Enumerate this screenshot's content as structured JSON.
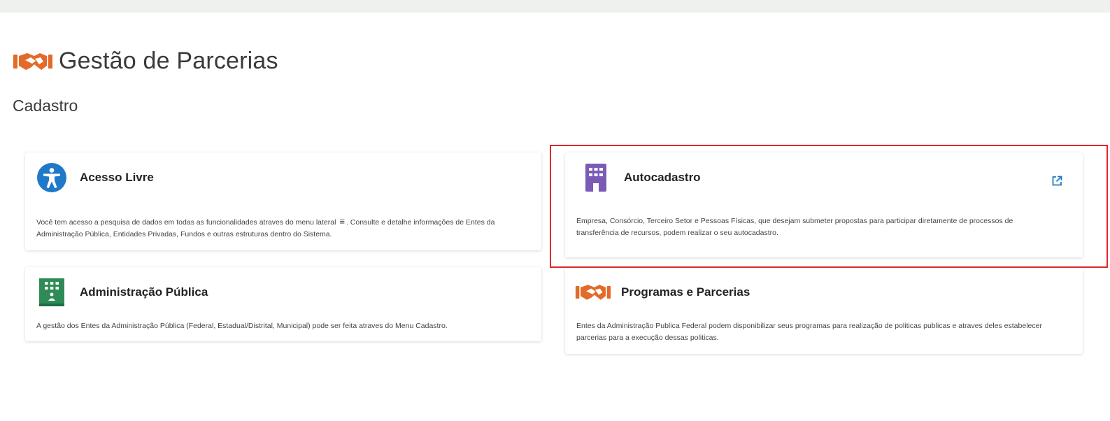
{
  "header": {
    "title": "Gestão de Parcerias",
    "logo_icon": "handshake-icon",
    "accent_color": "#e36a28"
  },
  "section": {
    "title": "Cadastro"
  },
  "cards": {
    "acesso_livre": {
      "title": "Acesso Livre",
      "icon": "accessibility-icon",
      "icon_color": "#1f79c9",
      "text_before_menu": "Você tem acesso a pesquisa de dados em todas as funcionalidades atraves do menu lateral",
      "menu_glyph": "≡",
      "text_after_menu": ". Consulte e detalhe informações de Entes da Administração Pública, Entidades Privadas, Fundos e outras estruturas dentro do Sistema."
    },
    "autocadastro": {
      "title": "Autocadastro",
      "icon": "building-icon",
      "icon_color": "#7b5bb6",
      "link_icon": "external-link-icon",
      "text": "Empresa, Consórcio, Terceiro Setor e Pessoas Físicas, que desejam submeter propostas para participar diretamente de processos de transferência de recursos, podem realizar o seu autocadastro."
    },
    "administracao_publica": {
      "title": "Administração Pública",
      "icon": "government-building-icon",
      "icon_color": "#2e8b57",
      "text": "A gestão dos Entes da Administração Pública (Federal, Estadual/Distrital, Municipal) pode ser feita atraves do Menu Cadastro."
    },
    "programas_parcerias": {
      "title": "Programas e Parcerias",
      "icon": "handshake-icon",
      "icon_color": "#e36a28",
      "text": "Entes da Administração Publica Federal podem disponibilizar seus programas para realização de politicas publicas e atraves deles estabelecer parcerias para a execução dessas politicas."
    }
  },
  "highlight_color": "#e0262c"
}
